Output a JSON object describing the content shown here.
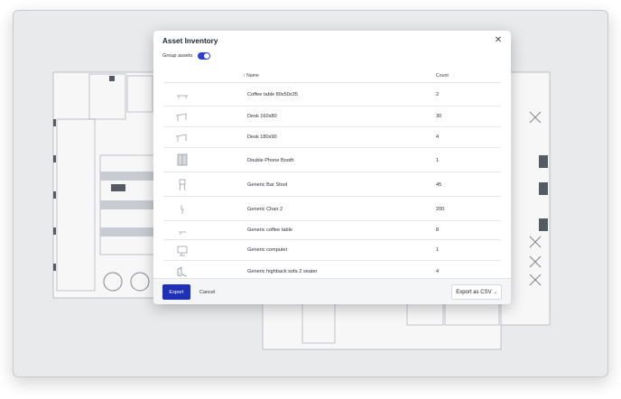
{
  "dialog": {
    "title": "Asset Inventory",
    "close_icon": "close-icon",
    "group_label": "Group assets",
    "group_enabled": true,
    "sort_indicator": "↑",
    "columns": {
      "name": "Name",
      "count": "Count"
    },
    "rows": [
      {
        "name": "Coffee table 80x50x35",
        "count": "2",
        "icon": "coffee-table-icon"
      },
      {
        "name": "Desk 160x80",
        "count": "30",
        "icon": "desk-icon"
      },
      {
        "name": "Desk 180x90",
        "count": "4",
        "icon": "desk-icon"
      },
      {
        "name": "Double Phone Booth",
        "count": "1",
        "icon": "phone-booth-icon"
      },
      {
        "name": "Generic Bar Stool",
        "count": "45",
        "icon": "bar-stool-icon"
      },
      {
        "name": "Generic Chair 2",
        "count": "200",
        "icon": "chair-icon"
      },
      {
        "name": "Generic coffee table",
        "count": "8",
        "icon": "coffee-table-icon"
      },
      {
        "name": "Generic computer",
        "count": "1",
        "icon": "computer-icon"
      },
      {
        "name": "Generic highback sofa 2 seater",
        "count": "4",
        "icon": "sofa-icon"
      }
    ]
  },
  "footer": {
    "export_label": "Export",
    "cancel_label": "Cancel",
    "csv_label": "Export as CSV",
    "csv_icon": "chevron-down-icon"
  },
  "colors": {
    "primary": "#1e2fb8",
    "toggle": "#2b3fd6"
  }
}
